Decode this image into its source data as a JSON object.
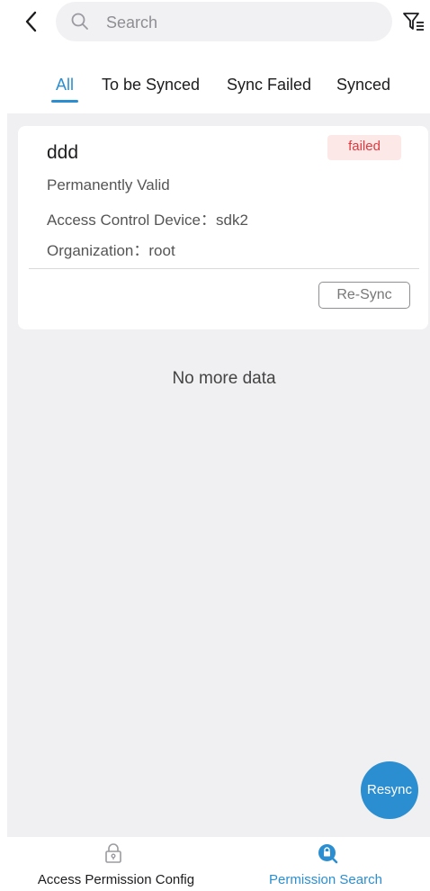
{
  "search": {
    "placeholder": "Search"
  },
  "tabs": [
    {
      "label": "All",
      "active": true
    },
    {
      "label": "To be Synced",
      "active": false
    },
    {
      "label": "Sync Failed",
      "active": false
    },
    {
      "label": "Synced",
      "active": false
    }
  ],
  "records": [
    {
      "name": "ddd",
      "status": "failed",
      "validity": "Permanently Valid",
      "device": "Access Control Device：sdk2",
      "organization": "Organization：root",
      "action_label": "Re-Sync"
    }
  ],
  "list_footer": "No more data",
  "fab_label": "Resync",
  "bottom_nav": [
    {
      "label": "Access Permission Config",
      "icon": "lock-outline-icon",
      "active": false
    },
    {
      "label": "Permission Search",
      "icon": "lock-search-icon",
      "active": true
    }
  ],
  "colors": {
    "accent": "#2b8ed1",
    "failed_text": "#e0383e",
    "failed_bg": "#fde8e8",
    "content_bg": "#f0f0f2"
  }
}
